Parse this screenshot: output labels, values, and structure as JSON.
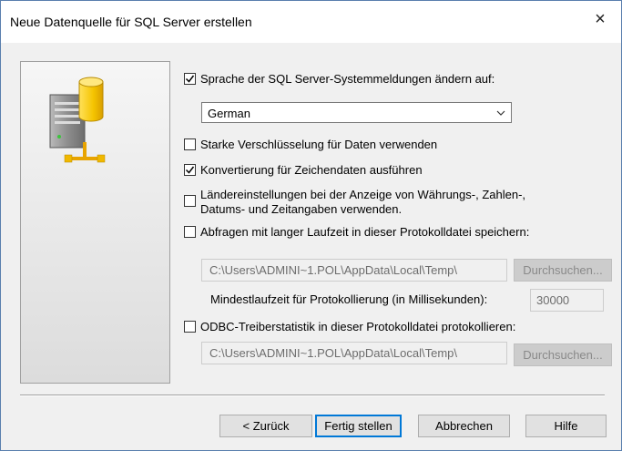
{
  "window": {
    "title": "Neue Datenquelle für SQL Server erstellen",
    "close_icon": "×"
  },
  "options": {
    "change_language": {
      "label": "Sprache der SQL Server-Systemmeldungen ändern auf:",
      "checked": true
    },
    "language_select": {
      "value": "German"
    },
    "strong_encryption": {
      "label": "Starke Verschlüsselung für Daten verwenden",
      "checked": false
    },
    "char_conversion": {
      "label": "Konvertierung für Zeichendaten ausführen",
      "checked": true
    },
    "regional_settings": {
      "label_line1": "Ländereinstellungen bei der Anzeige von Währungs-, Zahlen-,",
      "label_line2": "Datums- und Zeitangaben verwenden.",
      "checked": false
    },
    "long_queries": {
      "label": "Abfragen mit langer Laufzeit in dieser Protokolldatei speichern:",
      "checked": false
    },
    "long_queries_path": "C:\\Users\\ADMINI~1.POL\\AppData\\Local\\Temp\\",
    "long_queries_browse": "Durchsuchen...",
    "min_runtime_label": "Mindestlaufzeit für Protokollierung (in Millisekunden):",
    "min_runtime_value": "30000",
    "odbc_stats": {
      "label": "ODBC-Treiberstatistik in dieser Protokolldatei protokollieren:",
      "checked": false
    },
    "odbc_stats_path": "C:\\Users\\ADMINI~1.POL\\AppData\\Local\\Temp\\",
    "odbc_stats_browse": "Durchsuchen..."
  },
  "buttons": {
    "back": "< Zurück",
    "finish": "Fertig stellen",
    "cancel": "Abbrechen",
    "help": "Hilfe"
  },
  "icons": {
    "side_image": "database-server-network-icon",
    "dropdown": "chevron-down-icon",
    "checkmark": "checkmark-icon"
  },
  "colors": {
    "dialog_bg": "#f0f0f0",
    "accent": "#0078d7",
    "db_cylinder": "#f5c400",
    "network_line": "#e8a400"
  }
}
